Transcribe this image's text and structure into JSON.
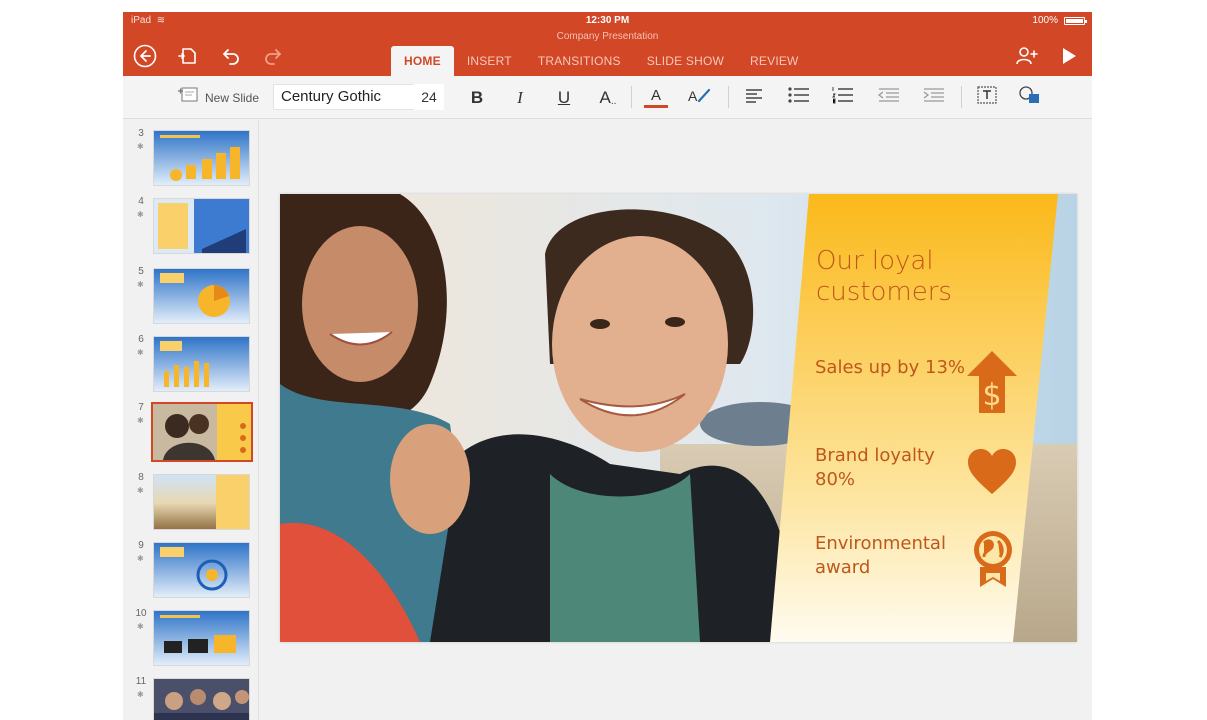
{
  "status": {
    "device": "iPad",
    "time": "12:30 PM",
    "battery": "100%",
    "battery_level": 1.0
  },
  "document": {
    "title": "Company Presentation"
  },
  "toolbar": {
    "tabs": [
      {
        "label": "HOME",
        "active": true
      },
      {
        "label": "INSERT",
        "active": false
      },
      {
        "label": "TRANSITIONS",
        "active": false
      },
      {
        "label": "SLIDE SHOW",
        "active": false
      },
      {
        "label": "REVIEW",
        "active": false
      }
    ],
    "back_icon": "back-arrow-icon",
    "file_icon": "file-save-icon",
    "undo_icon": "undo-icon",
    "redo_icon": "redo-icon",
    "share_icon": "add-person-icon",
    "play_icon": "play-icon"
  },
  "ribbon": {
    "new_slide_label": "New Slide",
    "font_name": "Century Gothic",
    "font_size": "24",
    "bold": "B",
    "italic": "I",
    "underline": "U",
    "font_style": "A",
    "font_color": "A",
    "accent_color": "#d24726"
  },
  "thumbnails": [
    {
      "number": "3"
    },
    {
      "number": "4"
    },
    {
      "number": "5"
    },
    {
      "number": "6"
    },
    {
      "number": "7",
      "selected": true
    },
    {
      "number": "8"
    },
    {
      "number": "9"
    },
    {
      "number": "10"
    },
    {
      "number": "11"
    }
  ],
  "slide": {
    "heading": "Our loyal customers",
    "stats": [
      {
        "text": "Sales up by 13%",
        "icon": "dollar-up-arrow-icon"
      },
      {
        "text": "Brand loyalty 80%",
        "icon": "heart-icon"
      },
      {
        "text": "Environmental award",
        "icon": "globe-award-icon"
      }
    ]
  },
  "colors": {
    "title_bar": "#d24726",
    "panel_text": "#c0571a",
    "panel_yellow": "#fbb91a"
  }
}
